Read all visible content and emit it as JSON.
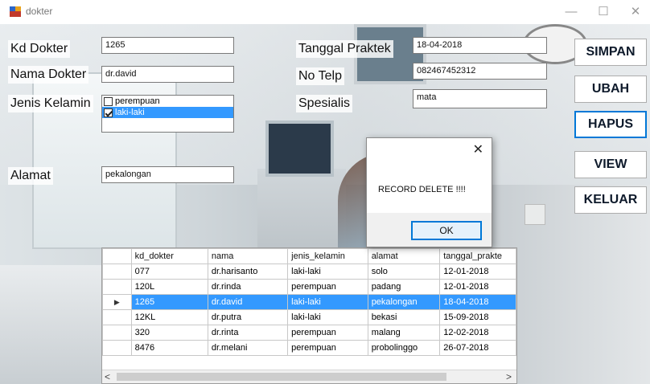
{
  "window": {
    "title": "dokter",
    "min": "—",
    "max": "☐",
    "close": "✕"
  },
  "form": {
    "kd_dokter_label": "Kd Dokter",
    "kd_dokter_value": "1265",
    "nama_dokter_label": "Nama Dokter",
    "nama_dokter_value": "dr.david",
    "jenis_kelamin_label": "Jenis Kelamin",
    "jenis_kelamin_options": [
      "perempuan",
      "laki-laki"
    ],
    "alamat_label": "Alamat",
    "alamat_value": "pekalongan",
    "tanggal_praktek_label": "Tanggal Praktek",
    "tanggal_praktek_value": "18-04-2018",
    "no_telp_label": "No Telp",
    "no_telp_value": "082467452312",
    "spesialis_label": "Spesialis",
    "spesialis_value": "mata"
  },
  "buttons": {
    "simpan": "SIMPAN",
    "ubah": "UBAH",
    "hapus": "HAPUS",
    "view": "VIEW",
    "keluar": "KELUAR"
  },
  "dialog": {
    "message": "RECORD DELETE !!!!",
    "ok": "OK",
    "close": "✕"
  },
  "grid": {
    "columns": [
      "kd_dokter",
      "nama",
      "jenis_kelamin",
      "alamat",
      "tanggal_prakte"
    ],
    "rows": [
      [
        "077",
        "dr.harisanto",
        "laki-laki",
        "solo",
        "12-01-2018"
      ],
      [
        "120L",
        "dr.rinda",
        "perempuan",
        "padang",
        "12-01-2018"
      ],
      [
        "1265",
        "dr.david",
        "laki-laki",
        "pekalongan",
        "18-04-2018"
      ],
      [
        "12KL",
        "dr.putra",
        "laki-laki",
        "bekasi",
        "15-09-2018"
      ],
      [
        "320",
        "dr.rinta",
        "perempuan",
        "malang",
        "12-02-2018"
      ],
      [
        "8476",
        "dr.melani",
        "perempuan",
        "probolinggo",
        "26-07-2018"
      ]
    ],
    "selected_row_marker": "▶",
    "scroll_left": "<",
    "scroll_right": ">"
  }
}
